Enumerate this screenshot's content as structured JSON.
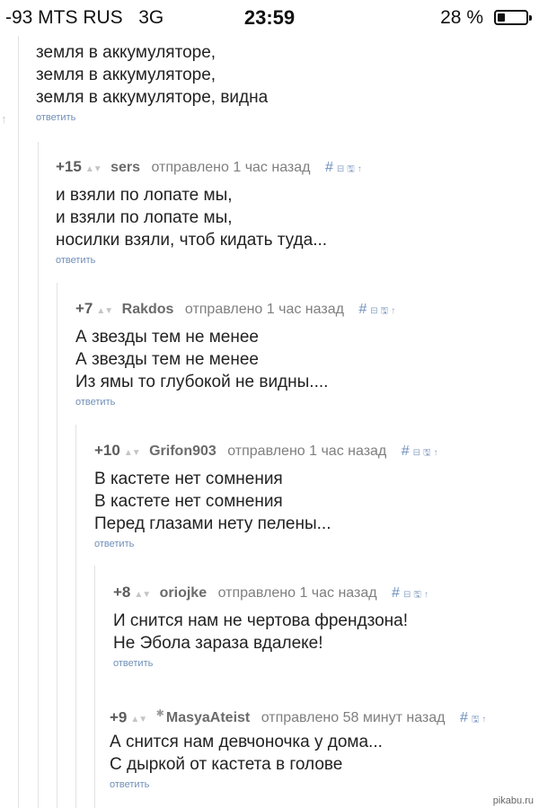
{
  "status_bar": {
    "carrier": "-93 MTS RUS",
    "network": "3G",
    "time": "23:59",
    "battery_percent": "28 %",
    "battery_level": 0.28
  },
  "reply_label": "ответить",
  "comments": [
    {
      "id": "c0",
      "lines": [
        "земля в аккумуляторе,",
        "земля в аккумуляторе,",
        "земля в аккумуляторе, видна"
      ],
      "reply": "ответить"
    },
    {
      "id": "c1",
      "rating": "+15",
      "author": "sers",
      "time": "отправлено 1 час назад",
      "hash": "#",
      "lines": [
        "и взяли по лопате мы,",
        "и взяли по лопате мы,",
        "носилки взяли, чтоб кидать туда..."
      ],
      "reply": "ответить"
    },
    {
      "id": "c2",
      "rating": "+7",
      "author": "Rakdos",
      "time": "отправлено 1 час назад",
      "hash": "#",
      "lines": [
        "А звезды тем не менее",
        "А звезды тем не менее",
        "Из ямы то глубокой не видны...."
      ],
      "reply": "ответить"
    },
    {
      "id": "c3",
      "rating": "+10",
      "author": "Grifon903",
      "time": "отправлено 1 час назад",
      "hash": "#",
      "lines": [
        "В кастете нет сомнения",
        "В кастете нет сомнения",
        "Перед глазами нету пелены..."
      ],
      "reply": "ответить"
    },
    {
      "id": "c4",
      "rating": "+8",
      "author": "oriojke",
      "time": "отправлено 1 час назад",
      "hash": "#",
      "lines": [
        "И снится нам не чертова френдзона!",
        "Не Эбола зараза вдалеке!"
      ],
      "reply": "ответить"
    },
    {
      "id": "c5",
      "rating": "+9",
      "author": "MasyaAteist",
      "time": "отправлено 58 минут назад",
      "hash": "#",
      "lines": [
        "А снится нам девчоночка у дома...",
        "С дыркой от кастета в голове"
      ],
      "reply": "ответить"
    }
  ],
  "watermark": "pikabu.ru",
  "colors": {
    "link": "#6f8fb8",
    "text": "#222222",
    "meta": "#8a8a8a",
    "thread_line": "#e2e2e2"
  }
}
